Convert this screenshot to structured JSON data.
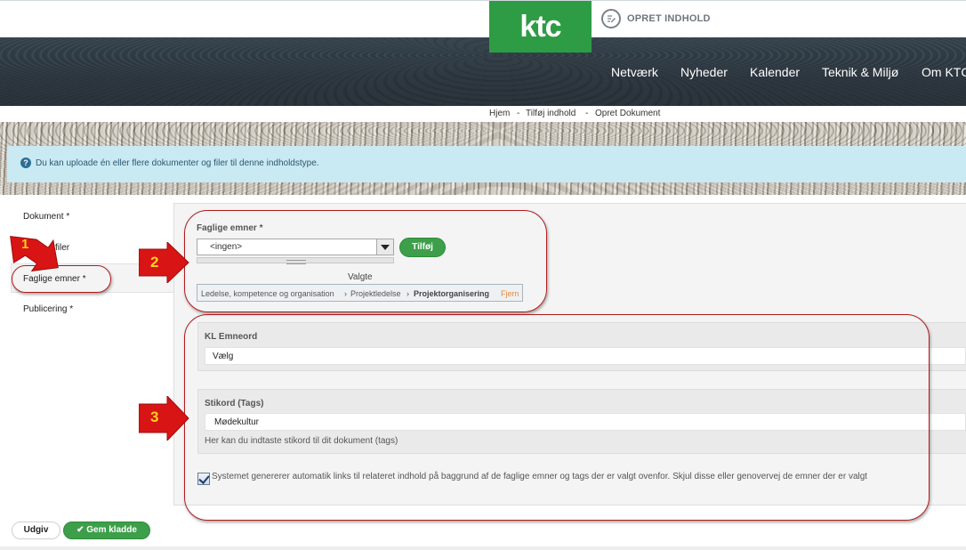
{
  "header": {
    "logo_text": "ktc",
    "create_content_label": "OPRET INDHOLD",
    "nav_items": [
      "Netværk",
      "Nyheder",
      "Kalender",
      "Teknik & Miljø",
      "Om KTC"
    ]
  },
  "breadcrumb": [
    "Hjem",
    "-",
    "Tilføj indhold",
    "-",
    "Opret Dokument"
  ],
  "info_message": "Du kan uploade én eller flere dokumenter og filer til denne indholdstype.",
  "sidebar": {
    "items": [
      {
        "label": "Dokument *"
      },
      {
        "label": "filer"
      },
      {
        "label": "Faglige emner *"
      },
      {
        "label": "Publicering *"
      }
    ]
  },
  "faglige_emner": {
    "label": "Faglige emner *",
    "select_value": "<ingen>",
    "add_button": "Tilføj",
    "chosen_heading": "Valgte",
    "chosen_path": [
      "Ledelse, kompetence og organisation",
      "›",
      "Projektledelse",
      "›",
      "Projektorganisering"
    ],
    "remove_label": "Fjern"
  },
  "kl_emneord": {
    "label": "KL Emneord",
    "value": "Vælg"
  },
  "stikord": {
    "label": "Stikord (Tags)",
    "value": "Mødekultur",
    "help": "Her kan du indtaste stikord til dit dokument (tags)"
  },
  "auto_links": {
    "checked": true,
    "text": "Systemet genererer automatik links til relateret indhold på baggrund af de faglige emner og tags der er valgt ovenfor. Skjul disse eller genovervej de emner der er valgt"
  },
  "footer_buttons": {
    "publish": "Udgiv",
    "save_draft": "Gem kladde"
  },
  "annotations": [
    "1",
    "2",
    "3"
  ],
  "colors": {
    "brand_green": "#2e9c45",
    "annotation_red": "#d81414",
    "info_bg": "#c9e9f3"
  }
}
